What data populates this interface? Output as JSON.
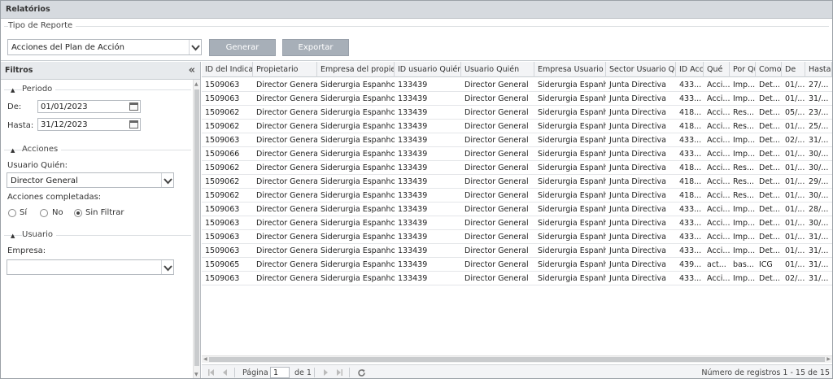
{
  "window": {
    "title": "Relatórios"
  },
  "report": {
    "legend": "Tipo de Reporte",
    "selected": "Acciones del Plan de Acción",
    "generate_label": "Generar",
    "export_label": "Exportar"
  },
  "filters": {
    "title": "Filtros",
    "collapse_glyph": "«",
    "period": {
      "label": "Periodo",
      "from_label": "De:",
      "from_value": "01/01/2023",
      "to_label": "Hasta:",
      "to_value": "31/12/2023"
    },
    "actions": {
      "label": "Acciones",
      "user_label": "Usuario Quién:",
      "user_value": "Director General",
      "completed_label": "Acciones completadas:",
      "options": [
        "Sí",
        "No",
        "Sin Filtrar"
      ],
      "selected": "Sin Filtrar"
    },
    "user": {
      "label": "Usuario",
      "company_label": "Empresa:",
      "company_value": ""
    }
  },
  "grid": {
    "columns": [
      "ID del Indicador",
      "Propietario",
      "Empresa del propietario",
      "ID usuario Quién",
      "Usuario Quién",
      "Empresa Usuario Quién",
      "Sector Usuario Quién",
      "ID Acción",
      "Qué",
      "Por Qué",
      "Como/",
      "De",
      "Hasta"
    ],
    "rows": [
      [
        "1509063",
        "Director General",
        "Siderurgia Espanhol",
        "133439",
        "Director General",
        "Siderurgia Espanh...",
        "Junta Directiva",
        "433...",
        "Acci...",
        "Imp...",
        "Det...",
        "01/...",
        "27/..."
      ],
      [
        "1509063",
        "Director General",
        "Siderurgia Espanhol",
        "133439",
        "Director General",
        "Siderurgia Espanh...",
        "Junta Directiva",
        "433...",
        "Acci...",
        "Imp...",
        "Det...",
        "01/...",
        "31/..."
      ],
      [
        "1509062",
        "Director General",
        "Siderurgia Espanhol",
        "133439",
        "Director General",
        "Siderurgia Espanh...",
        "Junta Directiva",
        "418...",
        "Acci...",
        "Res...",
        "Det...",
        "05/...",
        "23/..."
      ],
      [
        "1509062",
        "Director General",
        "Siderurgia Espanhol",
        "133439",
        "Director General",
        "Siderurgia Espanh...",
        "Junta Directiva",
        "418...",
        "Acci...",
        "Res...",
        "Det...",
        "01/...",
        "25/..."
      ],
      [
        "1509063",
        "Director General",
        "Siderurgia Espanhol",
        "133439",
        "Director General",
        "Siderurgia Espanh...",
        "Junta Directiva",
        "433...",
        "Acci...",
        "Imp...",
        "Det...",
        "02/...",
        "31/..."
      ],
      [
        "1509066",
        "Director General",
        "Siderurgia Espanhol",
        "133439",
        "Director General",
        "Siderurgia Espanh...",
        "Junta Directiva",
        "433...",
        "Acci...",
        "Imp...",
        "Det...",
        "01/...",
        "30/..."
      ],
      [
        "1509062",
        "Director General",
        "Siderurgia Espanhol",
        "133439",
        "Director General",
        "Siderurgia Espanh...",
        "Junta Directiva",
        "418...",
        "Acci...",
        "Res...",
        "Det...",
        "01/...",
        "30/..."
      ],
      [
        "1509062",
        "Director General",
        "Siderurgia Espanhol",
        "133439",
        "Director General",
        "Siderurgia Espanh...",
        "Junta Directiva",
        "418...",
        "Acci...",
        "Res...",
        "Det...",
        "01/...",
        "29/..."
      ],
      [
        "1509062",
        "Director General",
        "Siderurgia Espanhol",
        "133439",
        "Director General",
        "Siderurgia Espanh...",
        "Junta Directiva",
        "418...",
        "Acci...",
        "Res...",
        "Det...",
        "01/...",
        "30/..."
      ],
      [
        "1509063",
        "Director General",
        "Siderurgia Espanhol",
        "133439",
        "Director General",
        "Siderurgia Espanh...",
        "Junta Directiva",
        "433...",
        "Acci...",
        "Imp...",
        "Det...",
        "01/...",
        "28/..."
      ],
      [
        "1509063",
        "Director General",
        "Siderurgia Espanhol",
        "133439",
        "Director General",
        "Siderurgia Espanh...",
        "Junta Directiva",
        "433...",
        "Acci...",
        "Imp...",
        "Det...",
        "01/...",
        "30/..."
      ],
      [
        "1509063",
        "Director General",
        "Siderurgia Espanhol",
        "133439",
        "Director General",
        "Siderurgia Espanh...",
        "Junta Directiva",
        "433...",
        "Acci...",
        "Imp...",
        "Det...",
        "01/...",
        "31/..."
      ],
      [
        "1509063",
        "Director General",
        "Siderurgia Espanhol",
        "133439",
        "Director General",
        "Siderurgia Espanh...",
        "Junta Directiva",
        "433...",
        "Acci...",
        "Imp...",
        "Det...",
        "01/...",
        "31/..."
      ],
      [
        "1509065",
        "Director General",
        "Siderurgia Espanhol",
        "133439",
        "Director General",
        "Siderurgia Espanh...",
        "Junta Directiva",
        "439...",
        "act...",
        "bas...",
        "ICG",
        "01/...",
        "31/..."
      ],
      [
        "1509063",
        "Director General",
        "Siderurgia Espanhol",
        "133439",
        "Director General",
        "Siderurgia Espanh...",
        "Junta Directiva",
        "433...",
        "Acci...",
        "Imp...",
        "Det...",
        "02/...",
        "31/..."
      ]
    ]
  },
  "pager": {
    "page_label": "Página",
    "page_value": "1",
    "of_label": "de 1",
    "records_text": "Número de registros 1 - 15 de 15"
  }
}
